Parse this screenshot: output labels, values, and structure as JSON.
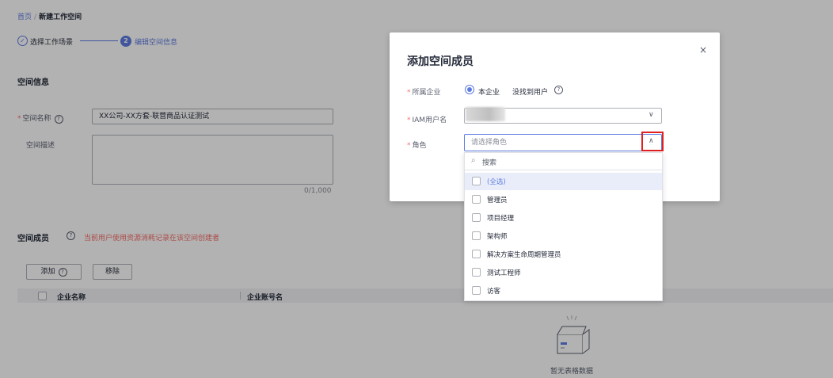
{
  "breadcrumb": {
    "home": "首页",
    "separator": "/",
    "current": "新建工作空间"
  },
  "steps": [
    {
      "number": "",
      "label": "选择工作场景",
      "status": "done"
    },
    {
      "number": "2",
      "label": "编辑空间信息",
      "status": "active"
    }
  ],
  "space_info": {
    "title": "空间信息",
    "name_label": "空间名称",
    "name_value": "XX公司-XX方套-联营商品认证测试",
    "desc_label": "空间描述",
    "desc_counter": "0/1,000"
  },
  "members": {
    "title": "空间成员",
    "warning": "当前用户使用资源消耗记录在该空间创建者",
    "add_button": "添加",
    "remove_button": "移除",
    "columns": [
      "企业名称",
      "企业账号名"
    ],
    "empty_text": "暂无表格数据"
  },
  "modal": {
    "title": "添加空间成员",
    "close": "×",
    "enterprise_label": "所属企业",
    "enterprise_option": "本企业",
    "not_found": "没找到用户",
    "iam_label": "IAM用户名",
    "role_label": "角色",
    "role_placeholder": "请选择角色",
    "required_mark": "*"
  },
  "dropdown": {
    "search_placeholder": "搜索",
    "options": [
      "(全选)",
      "管理员",
      "项目经理",
      "架构师",
      "解决方案生命周期管理员",
      "测试工程师",
      "访客"
    ]
  },
  "colors": {
    "brand": "#5e7ce0",
    "required": "#f66f6a",
    "highlight": "#e02020"
  },
  "icons": {
    "help": "?",
    "chevron_down": "∨",
    "chevron_up": "∧",
    "search": "⌕",
    "check": "✓"
  }
}
